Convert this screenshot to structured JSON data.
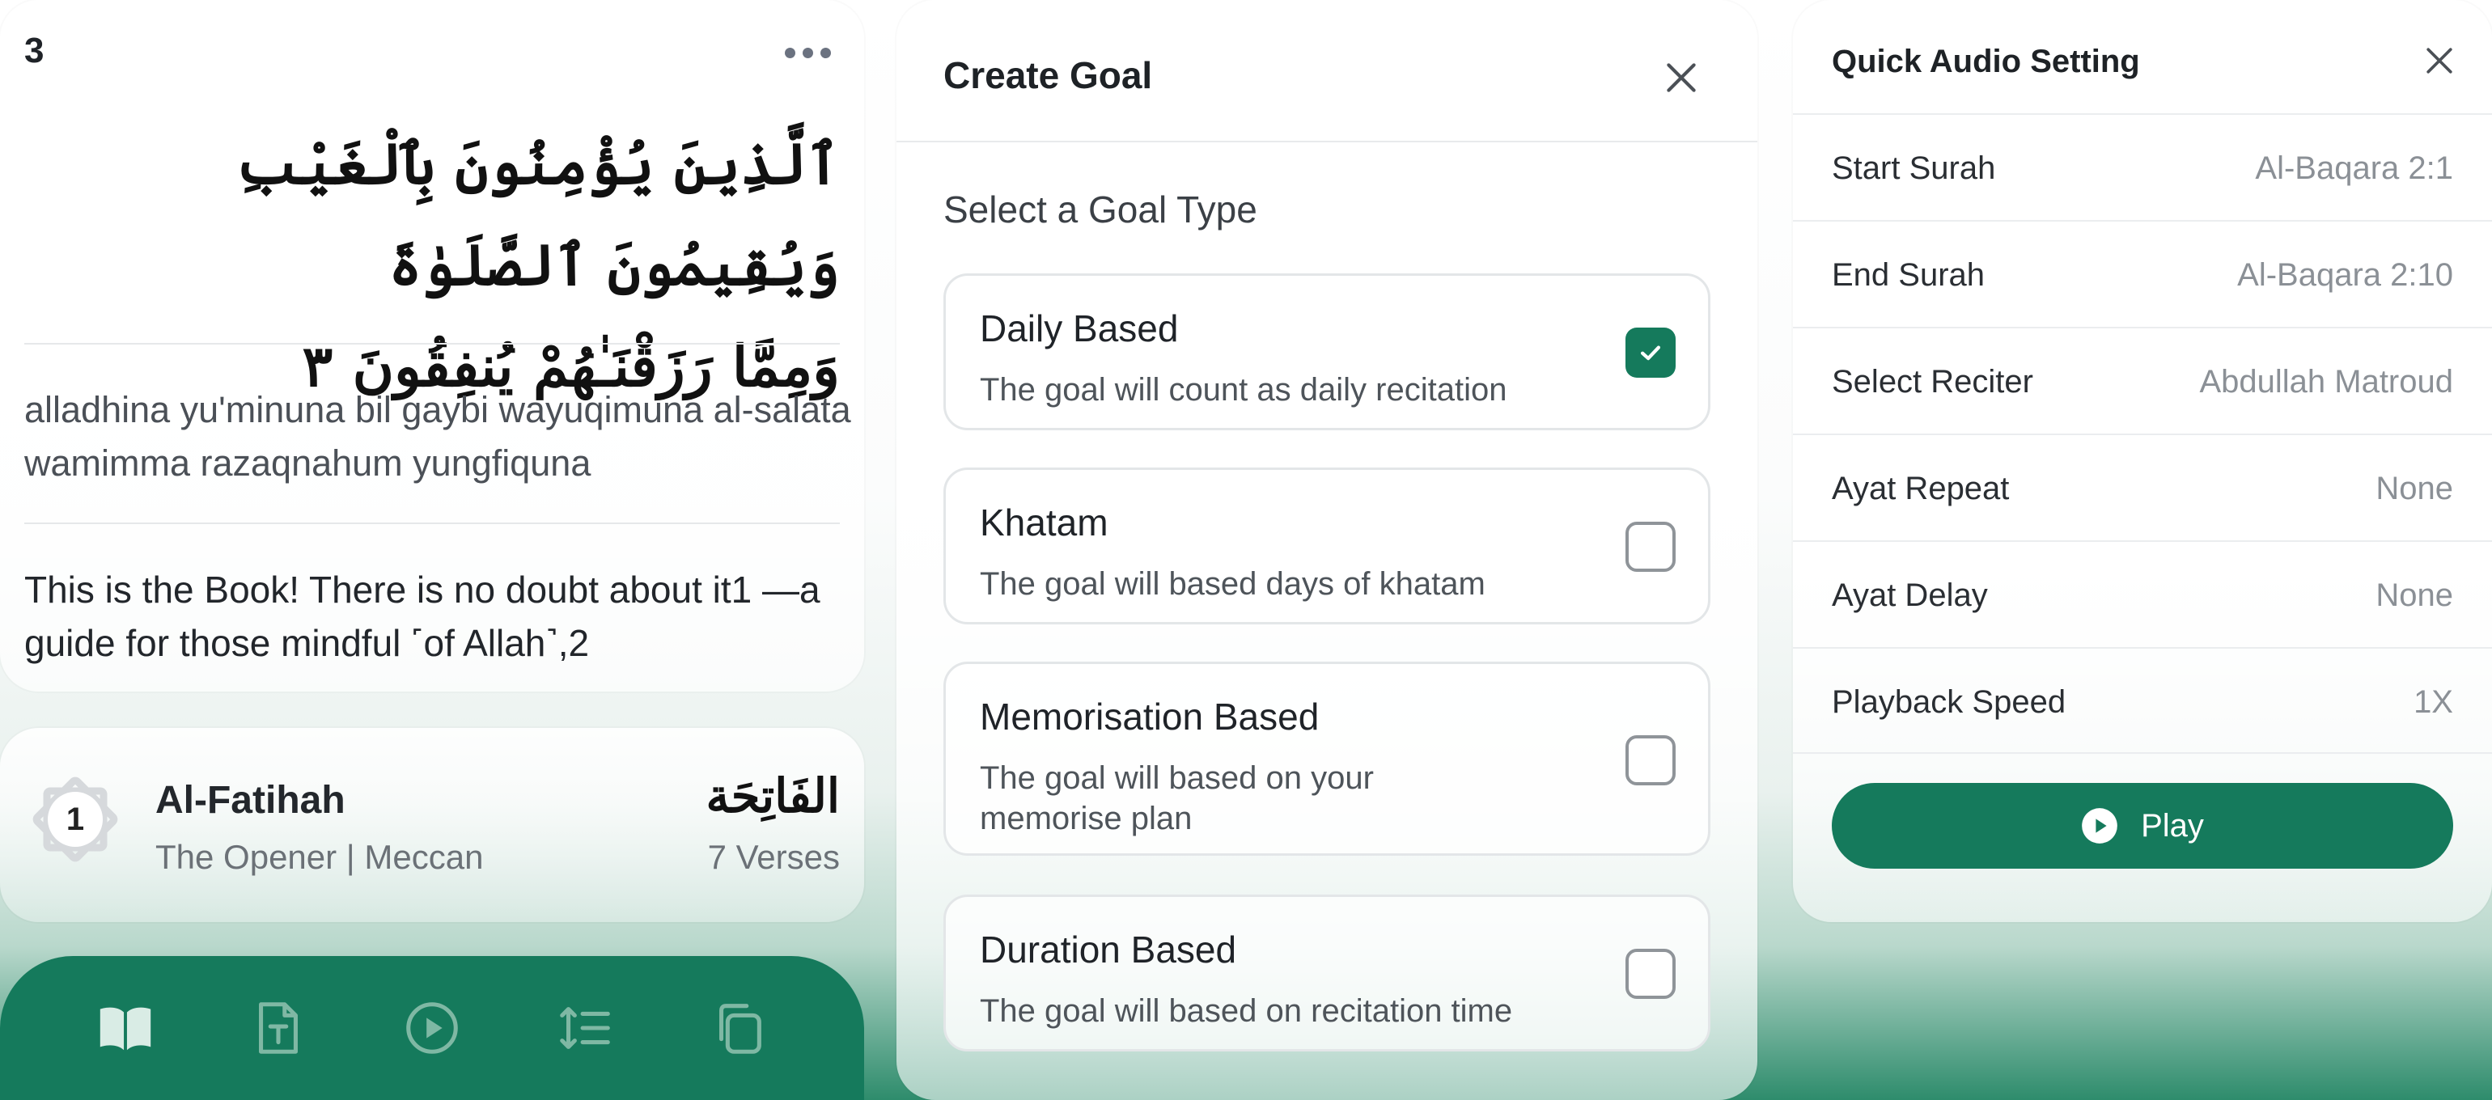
{
  "verse": {
    "number": "3",
    "arabic_line1": "ٱلَّذِينَ يُؤْمِنُونَ بِٱلْغَيْبِ وَيُقِيمُونَ ٱلصَّلَوٰةَ",
    "arabic_line2": "وَمِمَّا رَزَقْنَـٰهُمْ يُنفِقُونَ ٣",
    "transliteration": "alladhina yu'minuna bil gaybi wayuqimuna al-salata wamimma razaqnahum yungfiquna",
    "translation": "This is the Book! There is no doubt about it1 —a guide for those mindful ˹of Allah˺,2"
  },
  "surah": {
    "number": "1",
    "name": "Al-Fatihah",
    "meta": "The Opener | Meccan",
    "arabic_name": "الفَاتِحَة",
    "verses": "7 Verses"
  },
  "bottom_nav": {
    "icons": [
      "book-icon",
      "text-document-icon",
      "play-circle-icon",
      "line-spacing-icon",
      "copy-icon"
    ],
    "active_color": "#d9ece5",
    "inactive_color": "#7fb8a4"
  },
  "create_goal": {
    "title": "Create Goal",
    "section_label": "Select a Goal Type",
    "options": [
      {
        "title": "Daily Based",
        "desc": "The goal will count as daily recitation",
        "checked": true
      },
      {
        "title": "Khatam",
        "desc": "The goal will based days of khatam",
        "checked": false
      },
      {
        "title": "Memorisation Based",
        "desc": "The goal will based on your memorise plan",
        "checked": false
      },
      {
        "title": "Duration Based",
        "desc": "The goal will based on recitation time",
        "checked": false
      }
    ]
  },
  "audio_settings": {
    "title": "Quick Audio Setting",
    "rows": [
      {
        "label": "Start Surah",
        "value": "Al-Baqara 2:1"
      },
      {
        "label": "End Surah",
        "value": "Al-Baqara 2:10"
      },
      {
        "label": "Select Reciter",
        "value": "Abdullah Matroud"
      },
      {
        "label": "Ayat Repeat",
        "value": "None"
      },
      {
        "label": "Ayat Delay",
        "value": "None"
      },
      {
        "label": "Playback Speed",
        "value": "1X"
      }
    ],
    "play_label": "Play"
  },
  "colors": {
    "accent": "#157a5c",
    "muted_text": "#8b9096"
  }
}
